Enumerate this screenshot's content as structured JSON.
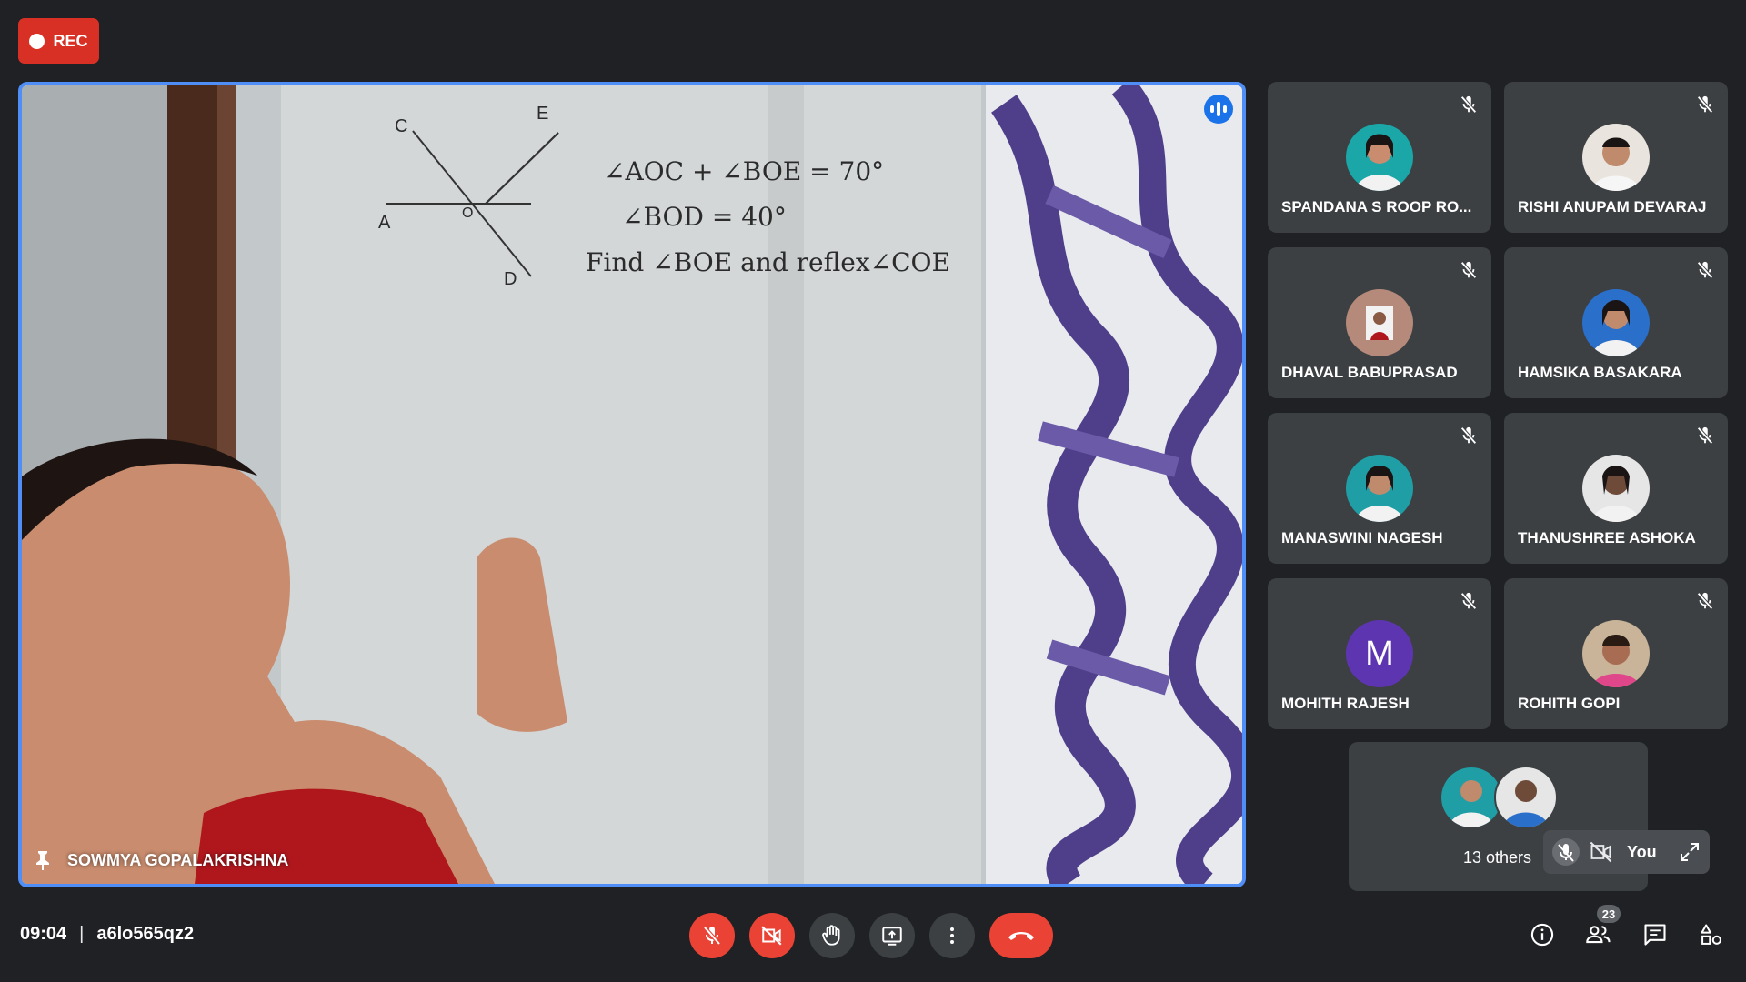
{
  "recording": {
    "label": "REC",
    "color": "#d93025"
  },
  "main_video": {
    "presenter_name": "SOWMYA GOPALAKRISHNA",
    "board": {
      "eq1": "∠AOC + ∠BOE = 70°",
      "eq2": "∠BOD = 40°",
      "eq3": "Find ∠BOE and reflex∠COE",
      "points": [
        "C",
        "E",
        "A",
        "O",
        "D"
      ]
    }
  },
  "participants": [
    {
      "name": "SPANDANA S ROOP RO...",
      "avatar_icon": "student-photo",
      "muted": true
    },
    {
      "name": "RISHI ANUPAM DEVARAJ",
      "avatar_icon": "student-photo",
      "muted": true
    },
    {
      "name": "DHAVAL BABUPRASAD",
      "avatar_icon": "student-photo",
      "muted": true
    },
    {
      "name": "HAMSIKA BASAKARA",
      "avatar_icon": "student-photo",
      "muted": true
    },
    {
      "name": "MANASWINI NAGESH",
      "avatar_icon": "student-photo",
      "muted": true
    },
    {
      "name": "THANUSHREE ASHOKA",
      "avatar_icon": "student-photo",
      "muted": true
    },
    {
      "name": "MOHITH RAJESH",
      "avatar_letter": "M",
      "avatar_color": "#5e35b1",
      "muted": true
    },
    {
      "name": "ROHITH GOPI",
      "avatar_icon": "student-photo",
      "muted": true
    }
  ],
  "others": {
    "label": "13 others"
  },
  "self": {
    "label": "You"
  },
  "meeting": {
    "time": "09:04",
    "separator": "|",
    "code": "a6lo565qz2"
  },
  "people_count": "23",
  "colors": {
    "accent": "#4f8ef7",
    "danger": "#ea4335",
    "tile_bg": "#3c4043",
    "page_bg": "#202124"
  }
}
